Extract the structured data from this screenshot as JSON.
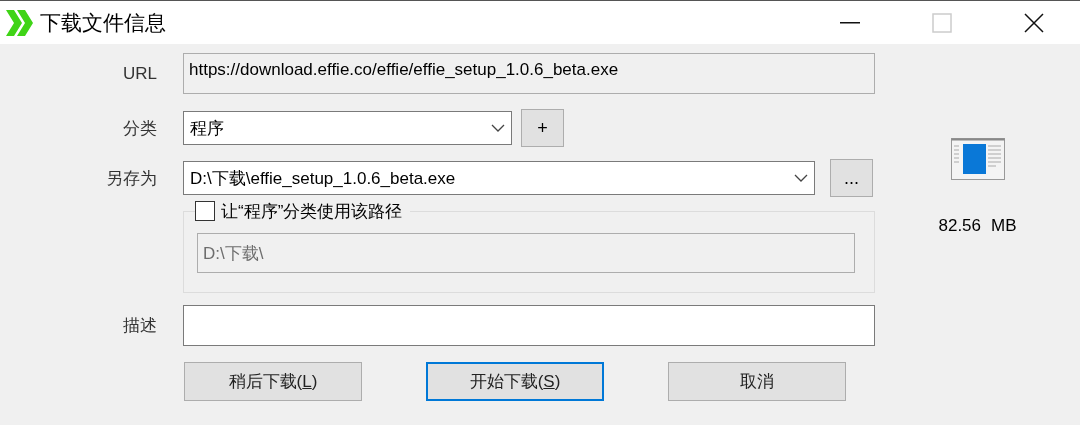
{
  "window": {
    "title": "下载文件信息"
  },
  "url": {
    "label": "URL",
    "value": "https://download.effie.co/effie/effie_setup_1.0.6_beta.exe"
  },
  "category": {
    "label": "分类",
    "value": "程序",
    "add_button": "+"
  },
  "save_as": {
    "label": "另存为",
    "value": "D:\\下载\\effie_setup_1.0.6_beta.exe",
    "browse_button": "..."
  },
  "category_path": {
    "label": "让“程序”分类使用该路径",
    "checked": false,
    "value": "D:\\下载\\",
    "disabled": true
  },
  "description": {
    "label": "描述"
  },
  "file_size": {
    "number": "82.56",
    "unit": "MB"
  },
  "buttons": [
    {
      "prefix": "稍后下载(",
      "key": "L",
      "suffix": ")",
      "focused": false
    },
    {
      "prefix": "开始下载(",
      "key": "S",
      "suffix": ")",
      "focused": true
    },
    {
      "prefix": "取消",
      "focused": false
    }
  ]
}
